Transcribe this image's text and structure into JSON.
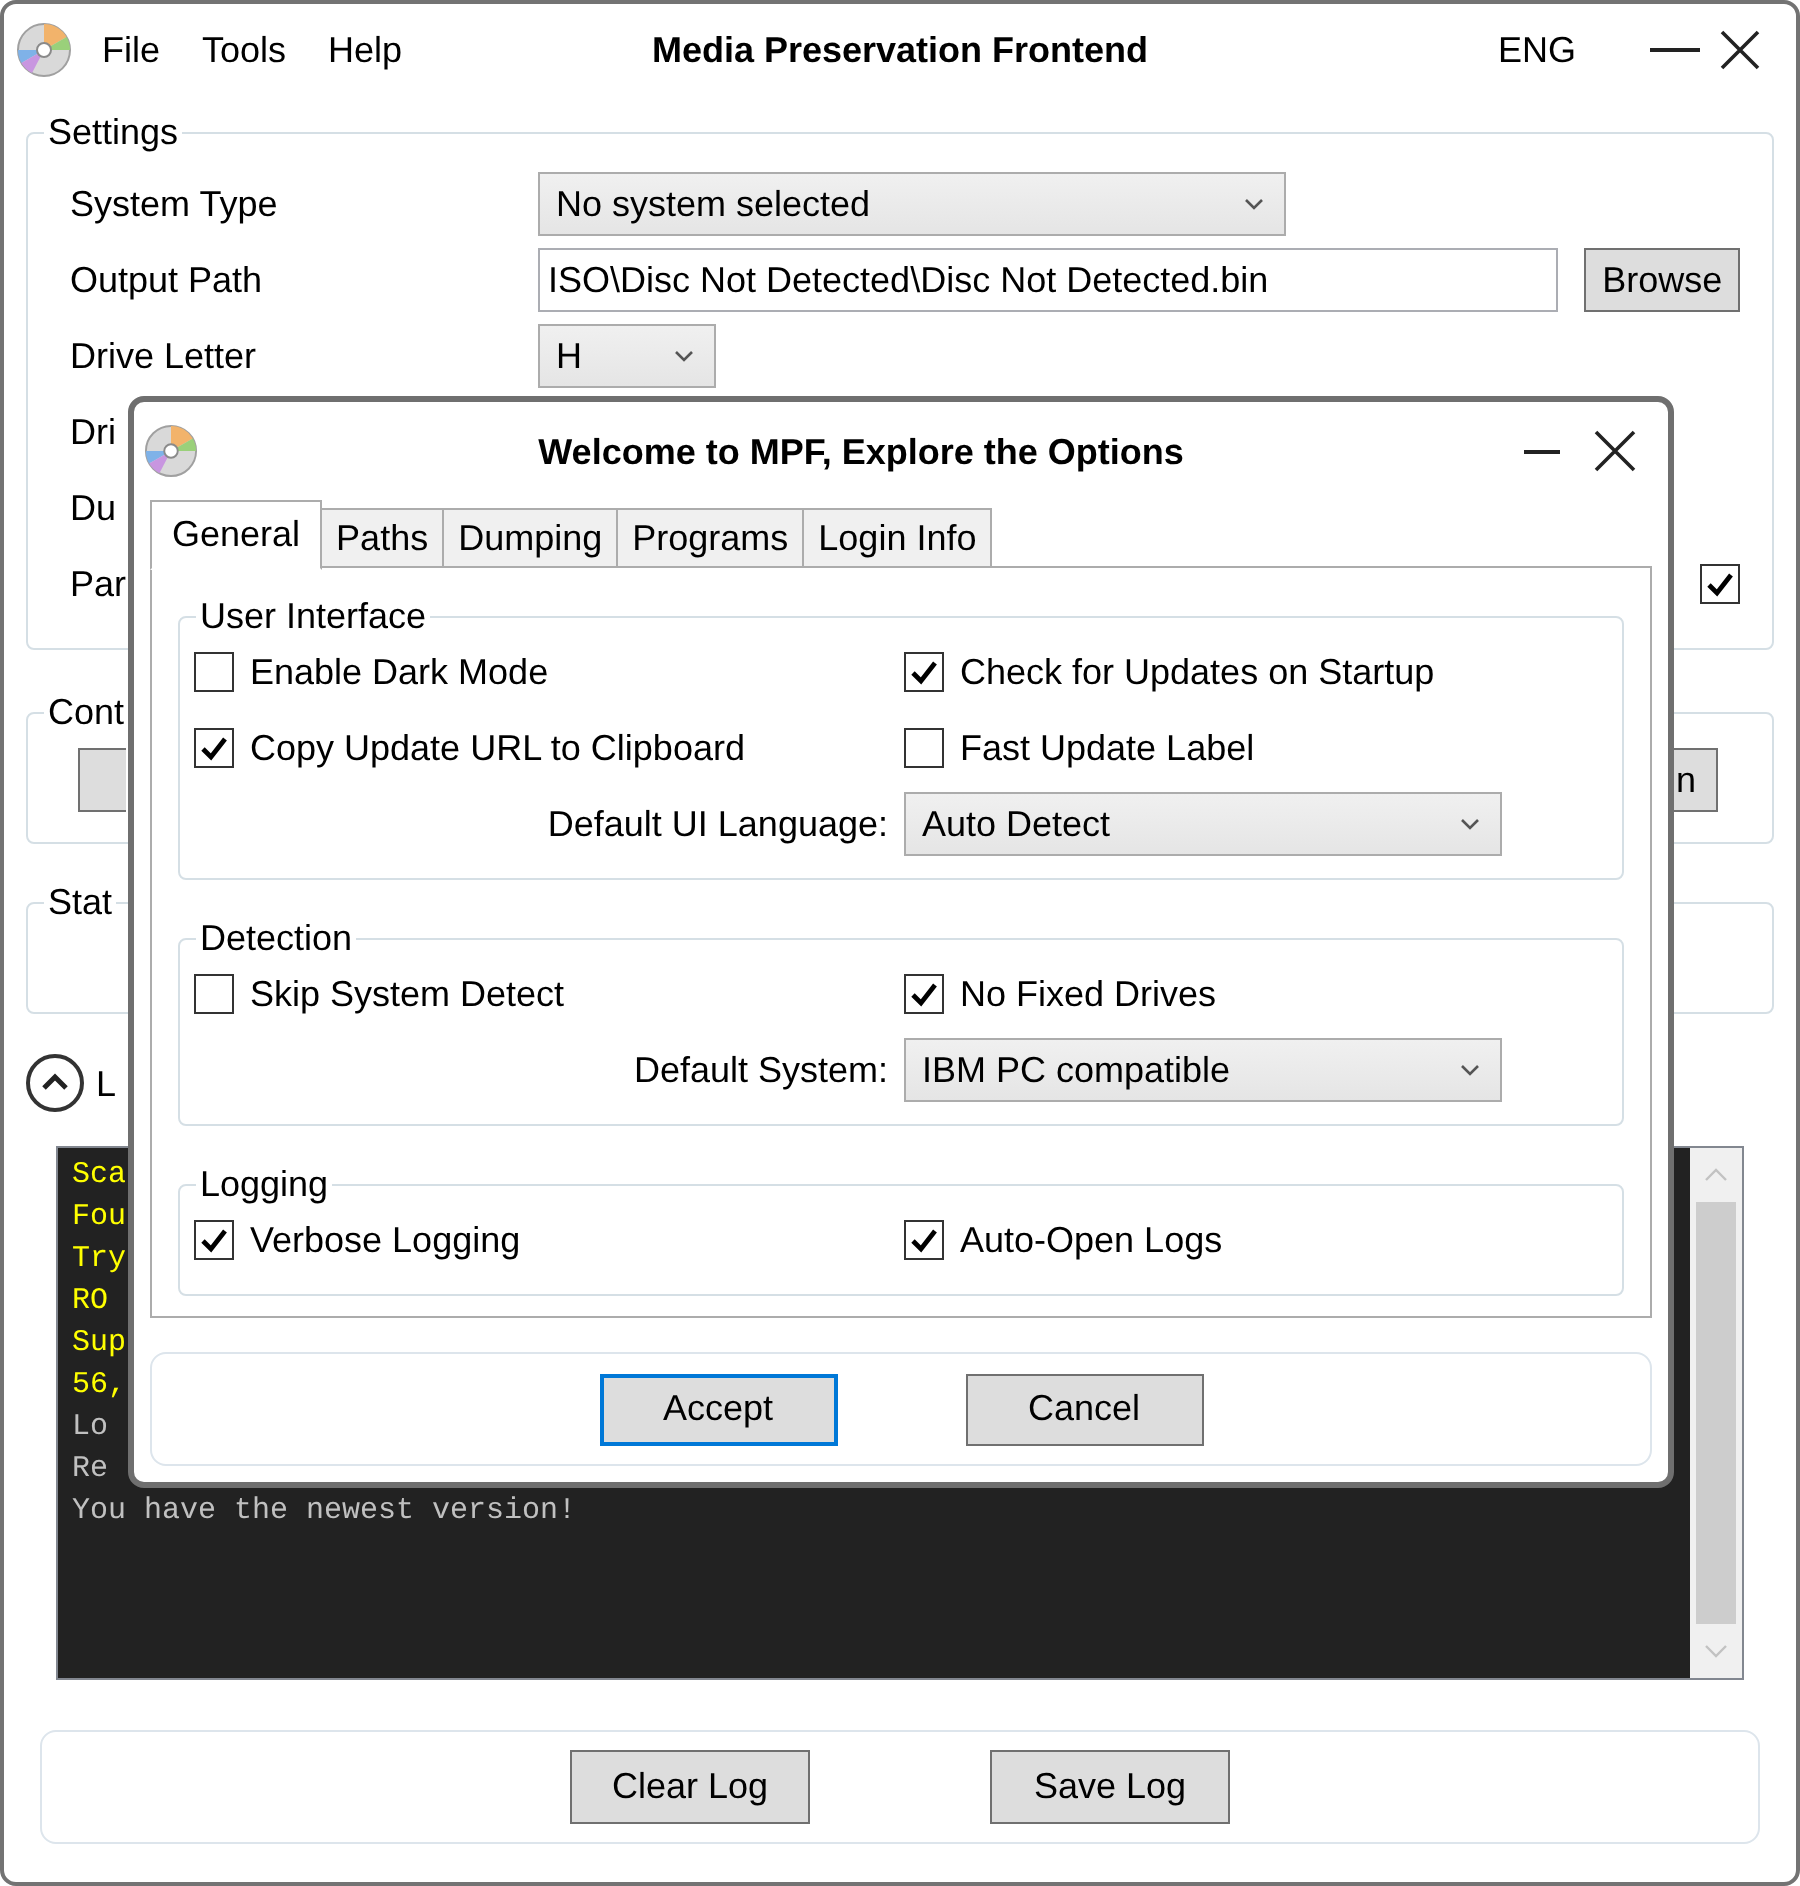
{
  "window": {
    "title": "Media Preservation Frontend",
    "menu": [
      "File",
      "Tools",
      "Help"
    ],
    "language": "ENG"
  },
  "settings": {
    "legend": "Settings",
    "rows": [
      {
        "kind": "select",
        "label": "System Type",
        "value": "No system selected"
      },
      {
        "kind": "path",
        "label": "Output Path",
        "value": "ISO\\Disc Not Detected\\Disc Not Detected.bin",
        "button": "Browse"
      },
      {
        "kind": "select_small",
        "label": "Drive Letter",
        "value": "H"
      },
      {
        "kind": "label",
        "label": "Dri"
      },
      {
        "kind": "label",
        "label": "Du"
      },
      {
        "kind": "checkbox",
        "label": "Par",
        "checked": true
      }
    ]
  },
  "controls": {
    "legend": "Cont",
    "button_label": "n"
  },
  "status": {
    "legend": "Stat"
  },
  "log": {
    "label": "L",
    "expanded": true,
    "lines": [
      {
        "text": "Sca",
        "color": "#ffff00"
      },
      {
        "text": "Fou",
        "color": "#ffff00"
      },
      {
        "text": "Try",
        "color": "#ffff00"
      },
      {
        "text": "RO",
        "color": "#ffff00"
      },
      {
        "text": "Sup",
        "color": "#ffff00"
      },
      {
        "text": "56,",
        "color": "#ffff00"
      },
      {
        "text": "Lo",
        "color": "#c0c0c0"
      },
      {
        "text": "Re",
        "color": "#c0c0c0"
      },
      {
        "text": "You have the newest version!",
        "color": "#c0c0c0"
      }
    ],
    "buttons": [
      "Clear Log",
      "Save Log"
    ]
  },
  "dialog": {
    "title": "Welcome to MPF, Explore the Options",
    "tabs": [
      {
        "label": "General",
        "selected": true
      },
      {
        "label": "Paths",
        "selected": false
      },
      {
        "label": "Dumping",
        "selected": false
      },
      {
        "label": "Programs",
        "selected": false
      },
      {
        "label": "Login Info",
        "selected": false
      }
    ],
    "groups": [
      {
        "legend": "User Interface",
        "items": [
          {
            "kind": "checkbox",
            "label": "Enable Dark Mode",
            "checked": false
          },
          {
            "kind": "checkbox",
            "label": "Check for Updates on Startup",
            "checked": true
          },
          {
            "kind": "checkbox",
            "label": "Copy Update URL to Clipboard",
            "checked": true
          },
          {
            "kind": "checkbox",
            "label": "Fast Update Label",
            "checked": false
          },
          {
            "kind": "select",
            "label": "Default UI Language:",
            "value": "Auto Detect"
          }
        ]
      },
      {
        "legend": "Detection",
        "items": [
          {
            "kind": "checkbox",
            "label": "Skip System Detect",
            "checked": false
          },
          {
            "kind": "checkbox",
            "label": "No Fixed Drives",
            "checked": true
          },
          {
            "kind": "select",
            "label": "Default System:",
            "value": "IBM PC compatible"
          }
        ]
      },
      {
        "legend": "Logging",
        "items": [
          {
            "kind": "checkbox",
            "label": "Verbose Logging",
            "checked": true
          },
          {
            "kind": "checkbox",
            "label": "Auto-Open Logs",
            "checked": true
          }
        ]
      }
    ],
    "buttons": [
      {
        "label": "Accept",
        "focused": true
      },
      {
        "label": "Cancel",
        "focused": false
      }
    ]
  }
}
